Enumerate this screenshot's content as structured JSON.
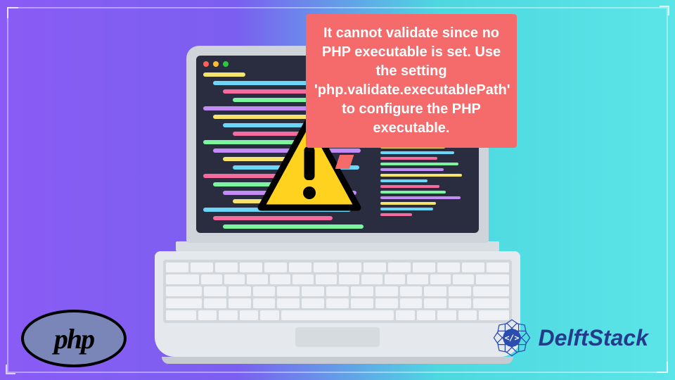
{
  "bubble": {
    "text": "It cannot validate since no PHP executable is set. Use the setting 'php.validate.executablePath' to configure the PHP executable."
  },
  "php_logo": {
    "text": "php"
  },
  "brand": {
    "name": "DelftStack"
  },
  "code_colors": [
    "#f5e36b",
    "#6bd6f5",
    "#f56b9e",
    "#7cf59e",
    "#c28bf5"
  ],
  "icons": {
    "warning": "warning-triangle-icon",
    "brand_badge": "delftstack-badge-icon"
  }
}
